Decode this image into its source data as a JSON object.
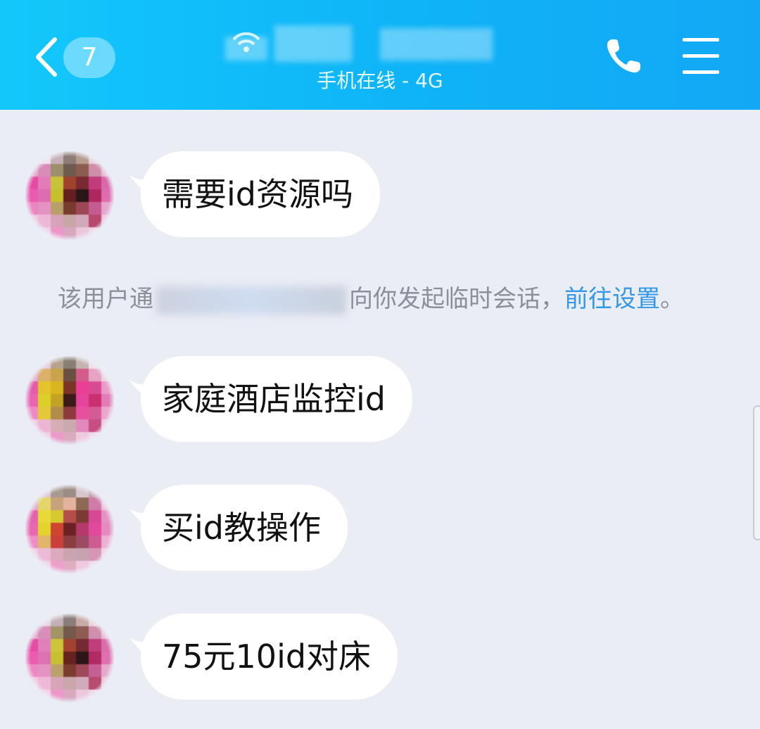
{
  "header": {
    "unread_count": "7",
    "status_text": "手机在线 - 4G"
  },
  "messages": [
    {
      "text": "需要id资源吗"
    },
    {
      "text": "家庭酒店监控id"
    },
    {
      "text": "买id教操作"
    },
    {
      "text": "75元10id对床"
    }
  ],
  "notice": {
    "prefix": "该用户通",
    "suffix": "向你发起临时会话，",
    "link": "前往设置",
    "end": "。"
  },
  "colors": {
    "header_start": "#12c8fb",
    "header_end": "#13a8f5",
    "background": "#ebedf5",
    "link": "#3399e6"
  },
  "icons": [
    "back-chevron-icon",
    "wifi-icon",
    "phone-icon",
    "menu-icon"
  ]
}
